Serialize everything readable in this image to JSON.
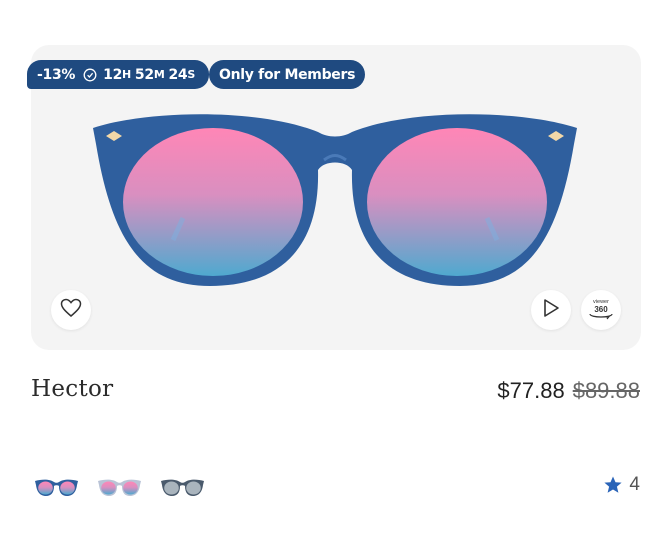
{
  "product": {
    "name": "Hector",
    "price": "$77.88",
    "old_price": "$89.88",
    "rating": "4"
  },
  "promo": {
    "discount": "-13%",
    "countdown": {
      "hours": "12",
      "hours_unit": "H",
      "minutes": "52",
      "minutes_unit": "M",
      "seconds": "24",
      "seconds_unit": "S"
    },
    "members_label": "Only for Members"
  },
  "actions": {
    "view360_top": "viewer",
    "view360_num": "360"
  },
  "colors": {
    "badge_bg": "#1f4a80",
    "frame": "#2f5f9e",
    "lens_top": "#ff7eb0",
    "lens_bottom": "#4aa8d0",
    "star": "#2a64b8"
  },
  "icons": [
    "clock-icon",
    "heart-icon",
    "play-icon",
    "view-360-icon",
    "star-icon"
  ],
  "swatches": [
    {
      "name": "blue-frame-pink-blue-lens"
    },
    {
      "name": "clear-frame-pink-blue-lens"
    },
    {
      "name": "dark-frame-grey-lens"
    }
  ]
}
